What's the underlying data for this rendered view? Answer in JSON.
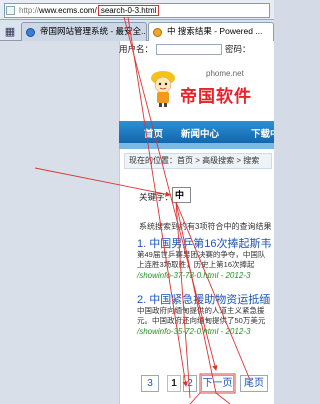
{
  "browser": {
    "url_protocol": "http://",
    "url_domain": "www.ecms.com/",
    "url_path": "search-0-3.html",
    "tabs": [
      {
        "label": "帝国网站管理系统 - 最安全..."
      },
      {
        "label": "中 搜索结果 - Powered ..."
      }
    ]
  },
  "site": {
    "login": {
      "username_label": "用户名：",
      "password_label": "密码："
    },
    "domain": "phome.net",
    "logo": "帝国软件",
    "nav": [
      "首页",
      "新闻中心",
      "下载中"
    ],
    "breadcrumb": "现在的位置：首页 > 高级搜索 > 搜索"
  },
  "search": {
    "keyword_label": "关键字：",
    "keyword_value": "中",
    "summary": "系统搜索到约有3项符合中的查询结果"
  },
  "results": [
    {
      "title": "1. 中国男乒第16次捧起斯韦",
      "desc1": "第49届世乒赛男团决赛的争夺，中国队",
      "desc2": "上连胜3场取胜，历史上第16次捧起",
      "link": "/showinfo-37-78-0.html - 2012-3"
    },
    {
      "title": "2. 中国紧急援助物资运抵缅",
      "desc1": "中国政府向缅甸提供的人道主义紧急援",
      "desc2": "元。中国政府还向缅甸提供了50万美元",
      "link": "/showinfo-35-72-0.html - 2012-3"
    }
  ],
  "pagination": {
    "items": [
      "3",
      "1",
      "2",
      "下一页",
      "尾页"
    ],
    "current": "1"
  },
  "colors": {
    "nav_blue": "#1167ae",
    "link_blue": "#1a55b8",
    "logo_red": "#e8222a",
    "annotation_red": "#d33"
  }
}
